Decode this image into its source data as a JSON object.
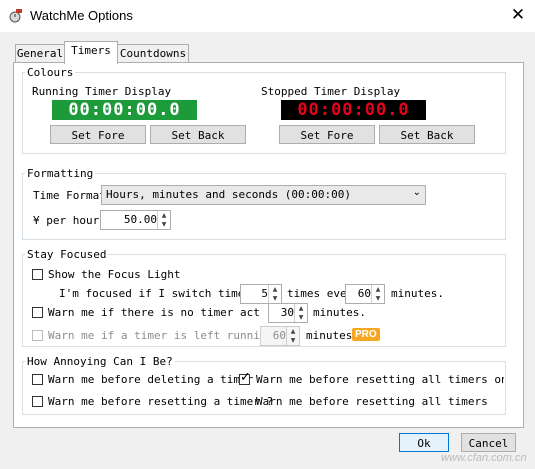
{
  "window": {
    "title": "WatchMe Options"
  },
  "tabs": [
    {
      "label": "General"
    },
    {
      "label": "Timers"
    },
    {
      "label": "Countdowns"
    }
  ],
  "colours": {
    "legend": "Colours",
    "running": {
      "label": "Running Timer Display",
      "display": "00:00:00.0",
      "bg": "#1d9a3a",
      "fg": "#ffffff",
      "set_fore": "Set Fore",
      "set_back": "Set Back"
    },
    "stopped": {
      "label": "Stopped Timer Display",
      "display": "00:00:00.0",
      "bg": "#000000",
      "fg": "#e8001c",
      "set_fore": "Set Fore",
      "set_back": "Set Back"
    }
  },
  "formatting": {
    "legend": "Formatting",
    "time_format_label": "Time Format",
    "time_format_value": "Hours, minutes and seconds (00:00:00)",
    "per_hour_label": "¥ per hour",
    "per_hour_value": "50.00"
  },
  "stay_focused": {
    "legend": "Stay Focused",
    "show_focus_light": "Show the Focus Light",
    "focused_text1": "I'm focused if I switch timers",
    "switch_times": "5",
    "focused_text2": "times ever",
    "focused_minutes": "60",
    "focused_text3": "minutes.",
    "no_timer_text1": "Warn me if there is no timer act",
    "no_timer_minutes": "30",
    "no_timer_text2": "minutes.",
    "left_running_text1": "Warn me if a timer is left running",
    "left_running_minutes": "60",
    "left_running_text2": "minutes.",
    "pro_badge": "PRO"
  },
  "annoying": {
    "legend": "How Annoying Can I Be?",
    "warn_delete": "Warn me before deleting a timer",
    "warn_reset_all_on": "Warn me before resetting all timers on a t",
    "warn_reset": "Warn me before resetting a timer ?",
    "warn_reset_all": "Warn me before resetting all timers"
  },
  "footer": {
    "ok": "Ok",
    "cancel": "Cancel"
  },
  "watermark": "www.cfan.com.cn"
}
